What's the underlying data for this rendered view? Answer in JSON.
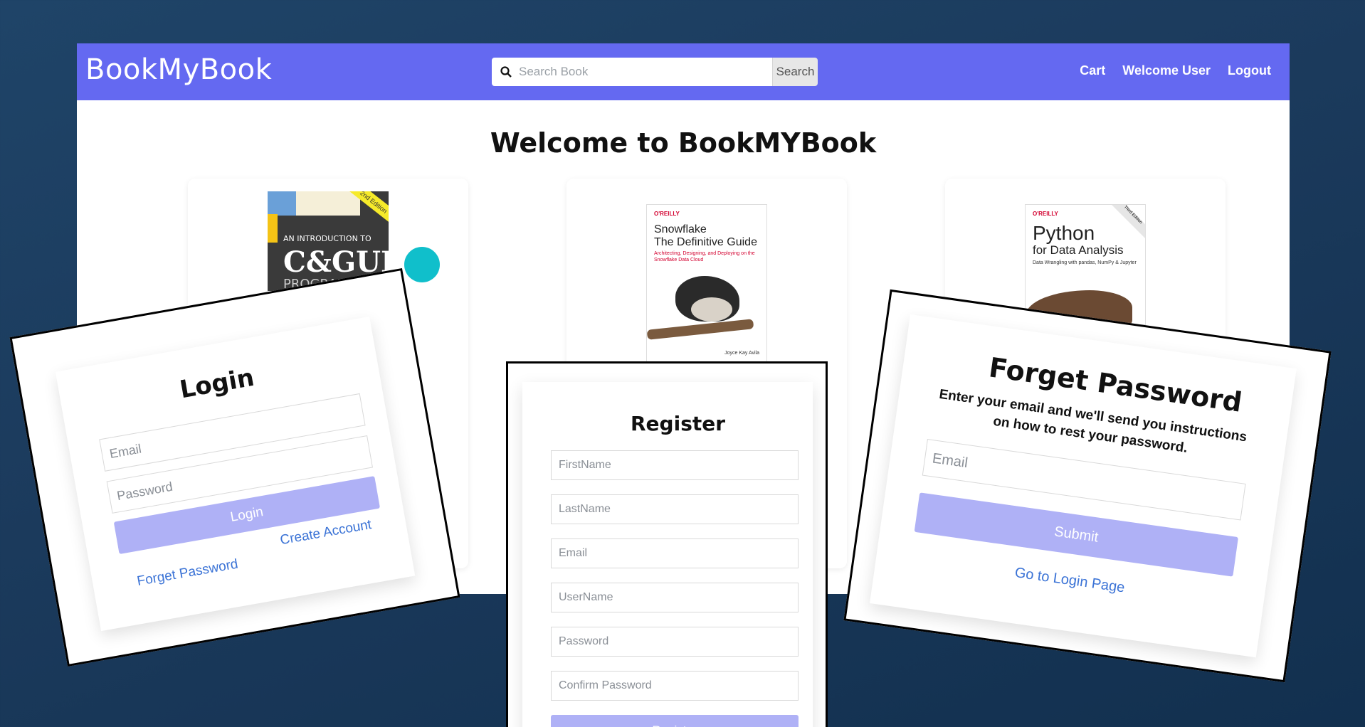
{
  "app": {
    "brand": "BookMyBook",
    "search": {
      "placeholder": "Search Book",
      "button": "Search"
    },
    "nav": {
      "cart": "Cart",
      "welcome": "Welcome User",
      "logout": "Logout"
    },
    "headline": "Welcome to BookMYBook",
    "books": [
      {
        "cover_lines": [
          "2nd Edition",
          "AN INTRODUCTION TO",
          "C&GUI",
          "PROGRAMMING"
        ]
      },
      {
        "cover_lines": [
          "O'REILLY",
          "Snowflake",
          "The Definitive Guide",
          "Architecting, Designing, and Deploying on the Snowflake Data Cloud",
          "Joyce Kay Avila"
        ]
      },
      {
        "cover_lines": [
          "O'REILLY",
          "Third Edition",
          "Python",
          "for Data Analysis",
          "Data Wrangling with pandas, NumPy & Jupyter"
        ]
      }
    ]
  },
  "login": {
    "title": "Login",
    "email_placeholder": "Email",
    "password_placeholder": "Password",
    "button": "Login",
    "forget_link": "Forget Password",
    "create_link": "Create Account"
  },
  "register": {
    "title": "Register",
    "firstname_placeholder": "FirstName",
    "lastname_placeholder": "LastName",
    "email_placeholder": "Email",
    "username_placeholder": "UserName",
    "password_placeholder": "Password",
    "confirm_placeholder": "Confirm Password",
    "button": "Register"
  },
  "forget": {
    "title": "Forget Password",
    "description": "Enter your email and we'll send you instructions on how to rest your password.",
    "email_placeholder": "Email",
    "button": "Submit",
    "login_link": "Go to Login Page"
  },
  "colors": {
    "navbar": "#6469f1",
    "button": "#afb1f6",
    "link": "#3b73d6",
    "accent_dot": "#10bfcb",
    "background": "#1b3a5c"
  }
}
